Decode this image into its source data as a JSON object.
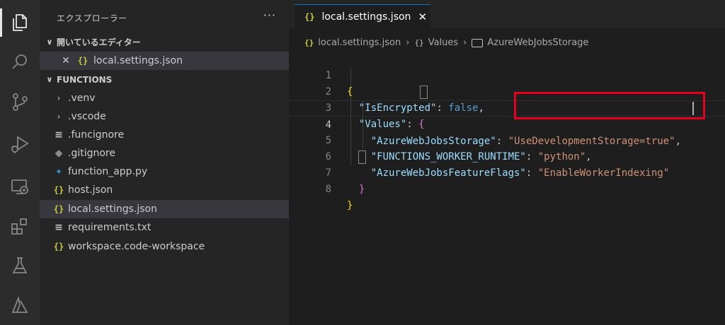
{
  "explorer": {
    "title": "エクスプローラー",
    "more": "···",
    "open_editors": {
      "header": "開いているエディター",
      "items": [
        {
          "close": "✕",
          "icon": "{}",
          "name": "local.settings.json"
        }
      ]
    },
    "folder": {
      "header": "FUNCTIONS",
      "items": [
        {
          "name": ".venv",
          "kind": "folder",
          "icon": "›"
        },
        {
          "name": ".vscode",
          "kind": "folder",
          "icon": "›"
        },
        {
          "name": ".funcignore",
          "kind": "file",
          "icon": "≡"
        },
        {
          "name": ".gitignore",
          "kind": "file",
          "icon": "◆"
        },
        {
          "name": "function_app.py",
          "kind": "file",
          "icon": "✦"
        },
        {
          "name": "host.json",
          "kind": "file",
          "icon": "{}"
        },
        {
          "name": "local.settings.json",
          "kind": "file",
          "icon": "{}",
          "selected": true
        },
        {
          "name": "requirements.txt",
          "kind": "file",
          "icon": "≡"
        },
        {
          "name": "workspace.code-workspace",
          "kind": "file",
          "icon": "{}"
        }
      ]
    }
  },
  "activity_icons": [
    "explorer-icon",
    "search-icon",
    "source-control-icon",
    "run-debug-icon",
    "remote-explorer-icon",
    "extensions-icon",
    "testing-icon",
    "azure-icon"
  ],
  "editor": {
    "tab": {
      "icon": "{}",
      "label": "local.settings.json",
      "close": "✕"
    },
    "breadcrumb": {
      "file": "local.settings.json",
      "obj_icon": "{}",
      "obj": "Values",
      "leaf": "AzureWebJobsStorage",
      "sep": "›"
    },
    "lines": [
      {
        "n": "1",
        "p1": "{"
      },
      {
        "n": "2",
        "indent": "  ",
        "key": "\"IsEncrypted\"",
        "colon": ": ",
        "bool": "false",
        "tail": ","
      },
      {
        "n": "3",
        "indent": "  ",
        "key": "\"Values\"",
        "colon": ": ",
        "brace": "{"
      },
      {
        "n": "4",
        "indent": "    ",
        "key": "\"AzureWebJobsStorage\"",
        "colon": ": ",
        "str": "\"UseDevelopmentStorage=true\"",
        "tail": ","
      },
      {
        "n": "5",
        "indent": "    ",
        "key": "\"FUNCTIONS_WORKER_RUNTIME\"",
        "colon": ": ",
        "str": "\"python\"",
        "tail": ","
      },
      {
        "n": "6",
        "indent": "    ",
        "key": "\"AzureWebJobsFeatureFlags\"",
        "colon": ": ",
        "str": "\"EnableWorkerIndexing\""
      },
      {
        "n": "7",
        "indent": "  ",
        "brace": "}"
      },
      {
        "n": "8",
        "p1": "}"
      }
    ]
  },
  "colors": {
    "accent": "#007acc",
    "highlight": "#e8001c",
    "json_icon": "#cbcb41"
  }
}
